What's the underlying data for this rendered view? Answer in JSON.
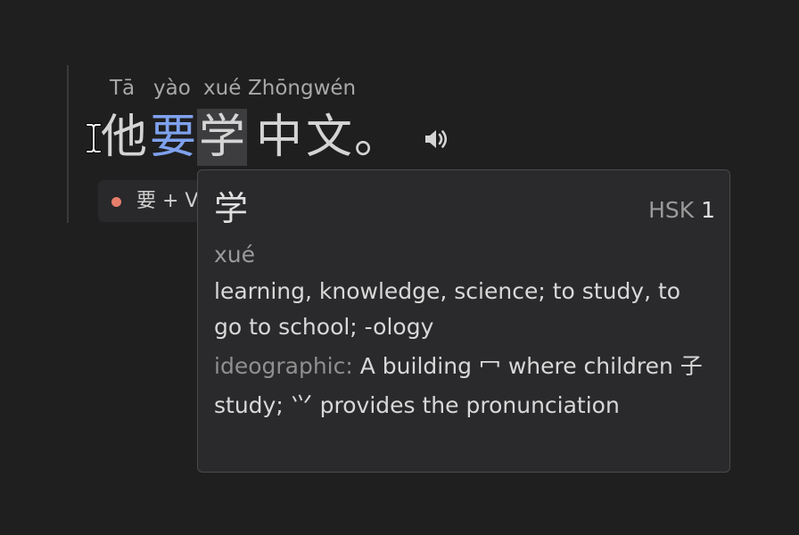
{
  "sentence": {
    "pinyin": [
      "Tā",
      "yào",
      "xué",
      "Zhōngwén"
    ],
    "characters": [
      "他",
      "要",
      "学",
      "中",
      "文",
      "。"
    ],
    "colors": {
      "default_char": "#d4d4d4",
      "highlight_char": "#7fa2ee",
      "selected_bg": "#3d3d3f"
    }
  },
  "icons": {
    "cursor": "text-cursor-icon",
    "audio": "speaker-icon"
  },
  "grammar_chip": {
    "label": "要 + V",
    "dot_color": "#e77d6b"
  },
  "popup": {
    "character": "学",
    "hsk_label": "HSK",
    "hsk_level": "1",
    "pinyin": "xué",
    "definition": "learning, knowledge, science; to study, to go to school; -ology",
    "etymology_label": "ideographic:",
    "etymology_text": "A building 冖 where children 子 study; ⺍ provides the pronunciation"
  }
}
